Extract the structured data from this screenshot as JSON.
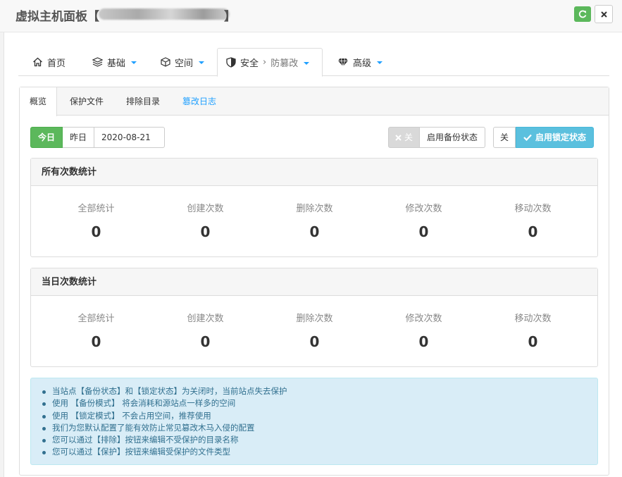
{
  "header": {
    "title": "虚拟主机面板【",
    "title_suffix": "】"
  },
  "main_tabs": [
    {
      "label": "首页",
      "icon": "home-icon"
    },
    {
      "label": "基础",
      "icon": "layers-icon"
    },
    {
      "label": "空间",
      "icon": "box-icon"
    },
    {
      "label": "安全",
      "sub": "防篡改",
      "icon": "shield-icon"
    },
    {
      "label": "高级",
      "icon": "diamond-icon"
    }
  ],
  "sub_tabs": [
    "概览",
    "保护文件",
    "排除目录",
    "篡改日志"
  ],
  "date_filter": {
    "today": "今日",
    "yesterday": "昨日",
    "date": "2020-08-21"
  },
  "backup": {
    "off_label": "关",
    "enable_label": "启用备份状态"
  },
  "lock": {
    "off_label": "关",
    "enable_label": "启用锁定状态"
  },
  "all_stats": {
    "title": "所有次数统计",
    "items": [
      {
        "label": "全部统计",
        "value": "0"
      },
      {
        "label": "创建次数",
        "value": "0"
      },
      {
        "label": "删除次数",
        "value": "0"
      },
      {
        "label": "修改次数",
        "value": "0"
      },
      {
        "label": "移动次数",
        "value": "0"
      }
    ]
  },
  "day_stats": {
    "title": "当日次数统计",
    "items": [
      {
        "label": "全部统计",
        "value": "0"
      },
      {
        "label": "创建次数",
        "value": "0"
      },
      {
        "label": "删除次数",
        "value": "0"
      },
      {
        "label": "修改次数",
        "value": "0"
      },
      {
        "label": "移动次数",
        "value": "0"
      }
    ]
  },
  "notes": [
    "当站点【备份状态】和【锁定状态】为关闭时，当前站点失去保护",
    "使用 【备份模式】 将会消耗和源站点一样多的空间",
    "使用 【锁定模式】 不会占用空间，推荐使用",
    "我们为您默认配置了能有效防止常见篡改木马入侵的配置",
    "您可以通过【排除】按钮来编辑不受保护的目录名称",
    "您可以通过【保护】按钮来编辑受保护的文件类型"
  ],
  "colors": {
    "accent": "#20a0ff",
    "green": "#5cb85c",
    "info": "#5bc0de",
    "alert_bg": "#d9edf7",
    "alert_text": "#31708f"
  }
}
